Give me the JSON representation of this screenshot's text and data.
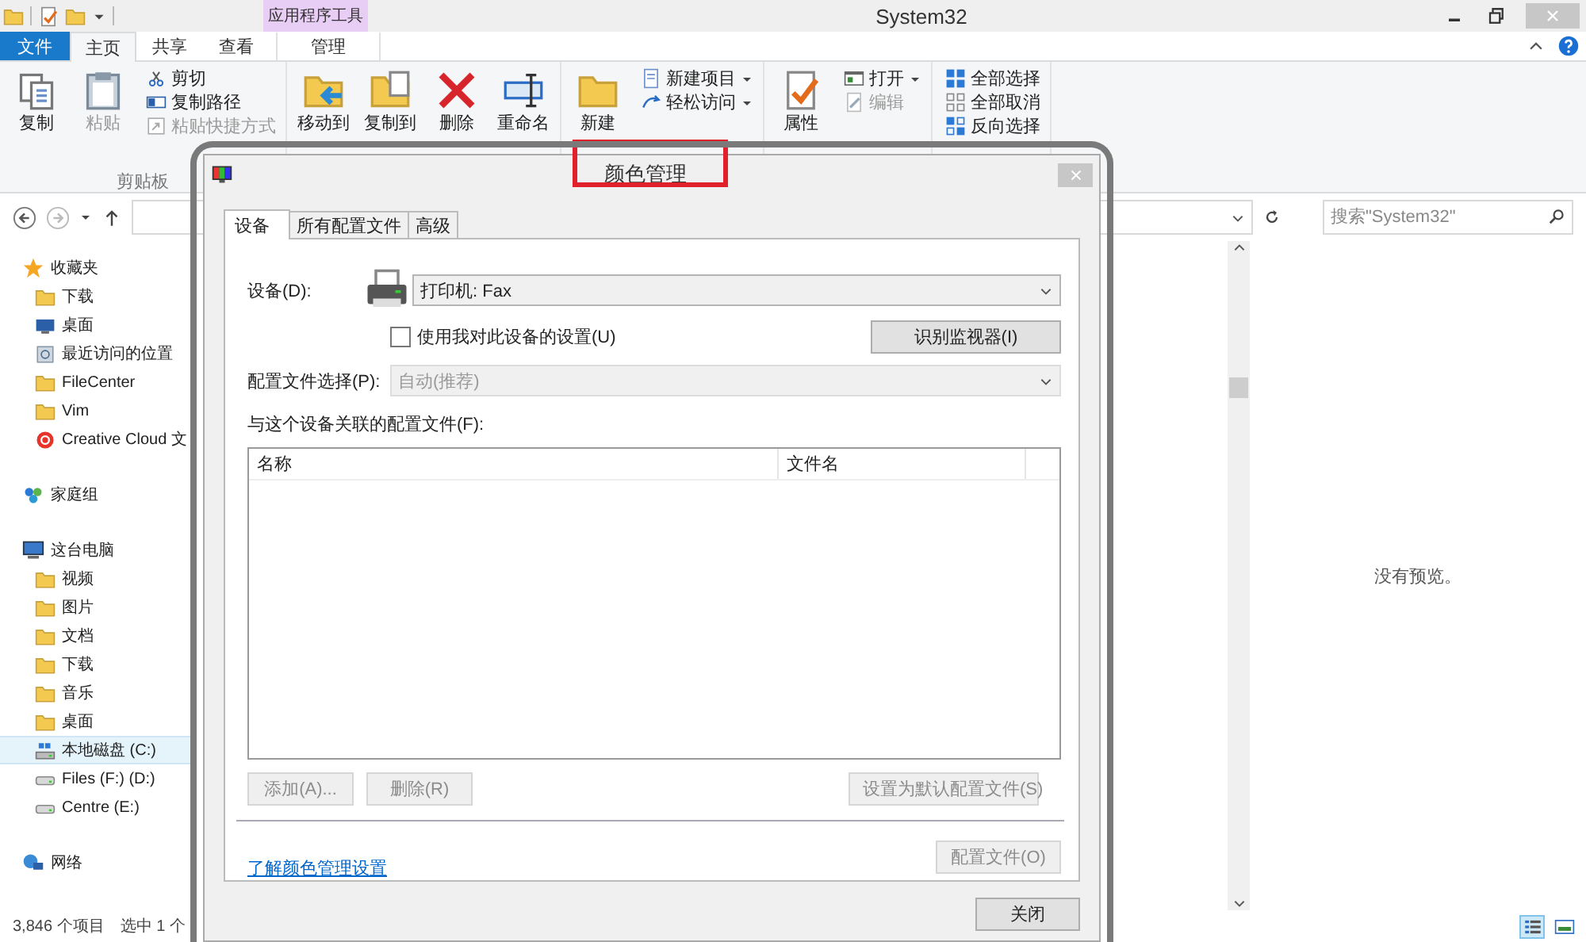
{
  "window": {
    "title": "System32",
    "context_group": "应用程序工具"
  },
  "ribbon_tabs": [
    {
      "label": "文件",
      "kind": "file",
      "selected": false
    },
    {
      "label": "主页",
      "kind": "tab",
      "selected": true
    },
    {
      "label": "共享",
      "kind": "tab",
      "selected": false
    },
    {
      "label": "查看",
      "kind": "tab",
      "selected": false
    },
    {
      "label": "管理",
      "kind": "context",
      "selected": false
    }
  ],
  "ribbon_groups": [
    {
      "label": "剪贴板",
      "items": [
        {
          "kind": "large",
          "label": "复制",
          "disabled": false
        },
        {
          "kind": "large",
          "label": "粘贴",
          "disabled": true
        },
        {
          "kind": "stack",
          "items": [
            {
              "label": "剪切",
              "dropdown": false,
              "disabled": false
            },
            {
              "label": "复制路径",
              "dropdown": false,
              "disabled": false
            },
            {
              "label": "粘贴快捷方式",
              "dropdown": false,
              "disabled": true
            }
          ]
        }
      ]
    },
    {
      "items": [
        {
          "kind": "large",
          "label": "移动到",
          "disabled": false
        },
        {
          "kind": "large",
          "label": "复制到",
          "disabled": false
        },
        {
          "kind": "large",
          "label": "删除",
          "disabled": false
        },
        {
          "kind": "large",
          "label": "重命名",
          "disabled": false
        }
      ]
    },
    {
      "items": [
        {
          "kind": "large",
          "label": "新建",
          "disabled": false
        },
        {
          "kind": "stack",
          "items": [
            {
              "label": "新建项目",
              "dropdown": true,
              "disabled": false
            },
            {
              "label": "轻松访问",
              "dropdown": true,
              "disabled": false
            }
          ]
        }
      ]
    },
    {
      "items": [
        {
          "kind": "large",
          "label": "属性",
          "disabled": false
        },
        {
          "kind": "stack",
          "items": [
            {
              "label": "打开",
              "dropdown": true,
              "disabled": false
            },
            {
              "label": "编辑",
              "dropdown": false,
              "disabled": true
            }
          ]
        }
      ]
    },
    {
      "items": [
        {
          "kind": "stack",
          "items": [
            {
              "label": "全部选择",
              "dropdown": false,
              "disabled": false
            },
            {
              "label": "全部取消",
              "dropdown": false,
              "disabled": false
            },
            {
              "label": "反向选择",
              "dropdown": false,
              "disabled": false
            }
          ]
        }
      ]
    }
  ],
  "search": {
    "placeholder": "搜索\"System32\""
  },
  "nav_pane": [
    {
      "label": "收藏夹",
      "selected": false,
      "children": [
        {
          "label": "下载",
          "selected": false
        },
        {
          "label": "桌面",
          "selected": false
        },
        {
          "label": "最近访问的位置",
          "selected": false
        },
        {
          "label": "FileCenter",
          "selected": false
        },
        {
          "label": "Vim",
          "selected": false
        },
        {
          "label": "Creative Cloud 文",
          "selected": false
        }
      ]
    },
    {
      "label": "家庭组",
      "selected": false
    },
    {
      "label": "这台电脑",
      "selected": false,
      "children": [
        {
          "label": "视频",
          "selected": false
        },
        {
          "label": "图片",
          "selected": false
        },
        {
          "label": "文档",
          "selected": false
        },
        {
          "label": "下载",
          "selected": false
        },
        {
          "label": "音乐",
          "selected": false
        },
        {
          "label": "桌面",
          "selected": false
        },
        {
          "label": "本地磁盘 (C:)",
          "selected": true
        },
        {
          "label": "Files (F:) (D:)",
          "selected": false
        },
        {
          "label": "Centre (E:)",
          "selected": false
        }
      ]
    },
    {
      "label": "网络",
      "selected": false
    }
  ],
  "preview": {
    "message": "没有预览。"
  },
  "view_buttons": [
    {
      "selected": true
    },
    {
      "selected": false
    }
  ],
  "status_bar": {
    "item_count": "3,846 个项目",
    "selection": "选中 1 个"
  },
  "dialog": {
    "title": "颜色管理",
    "title_highlighted": true,
    "framed": true,
    "tabs": [
      {
        "label": "设备",
        "selected": true
      },
      {
        "label": "所有配置文件",
        "selected": false
      },
      {
        "label": "高级",
        "selected": false
      }
    ],
    "device": {
      "label": "设备(D):",
      "value": "打印机: Fax"
    },
    "use_my_settings": {
      "label": "使用我对此设备的设置(U)",
      "checked": false
    },
    "identify_button": {
      "label": "识别监视器(I)",
      "disabled": false
    },
    "profile_selection": {
      "label": "配置文件选择(P):",
      "value": "自动(推荐)",
      "disabled": true
    },
    "associated_profiles": {
      "label": "与这个设备关联的配置文件(F):",
      "columns": [
        "名称",
        "文件名"
      ]
    },
    "list_buttons": [
      {
        "label": "添加(A)...",
        "disabled": true
      },
      {
        "label": "删除(R)",
        "disabled": true
      },
      {
        "label": "设置为默认配置文件(S)",
        "disabled": true
      }
    ],
    "link": "了解颜色管理设置",
    "profiles_button": {
      "label": "配置文件(O)",
      "disabled": true
    },
    "close_button": {
      "label": "关闭",
      "disabled": false
    }
  }
}
